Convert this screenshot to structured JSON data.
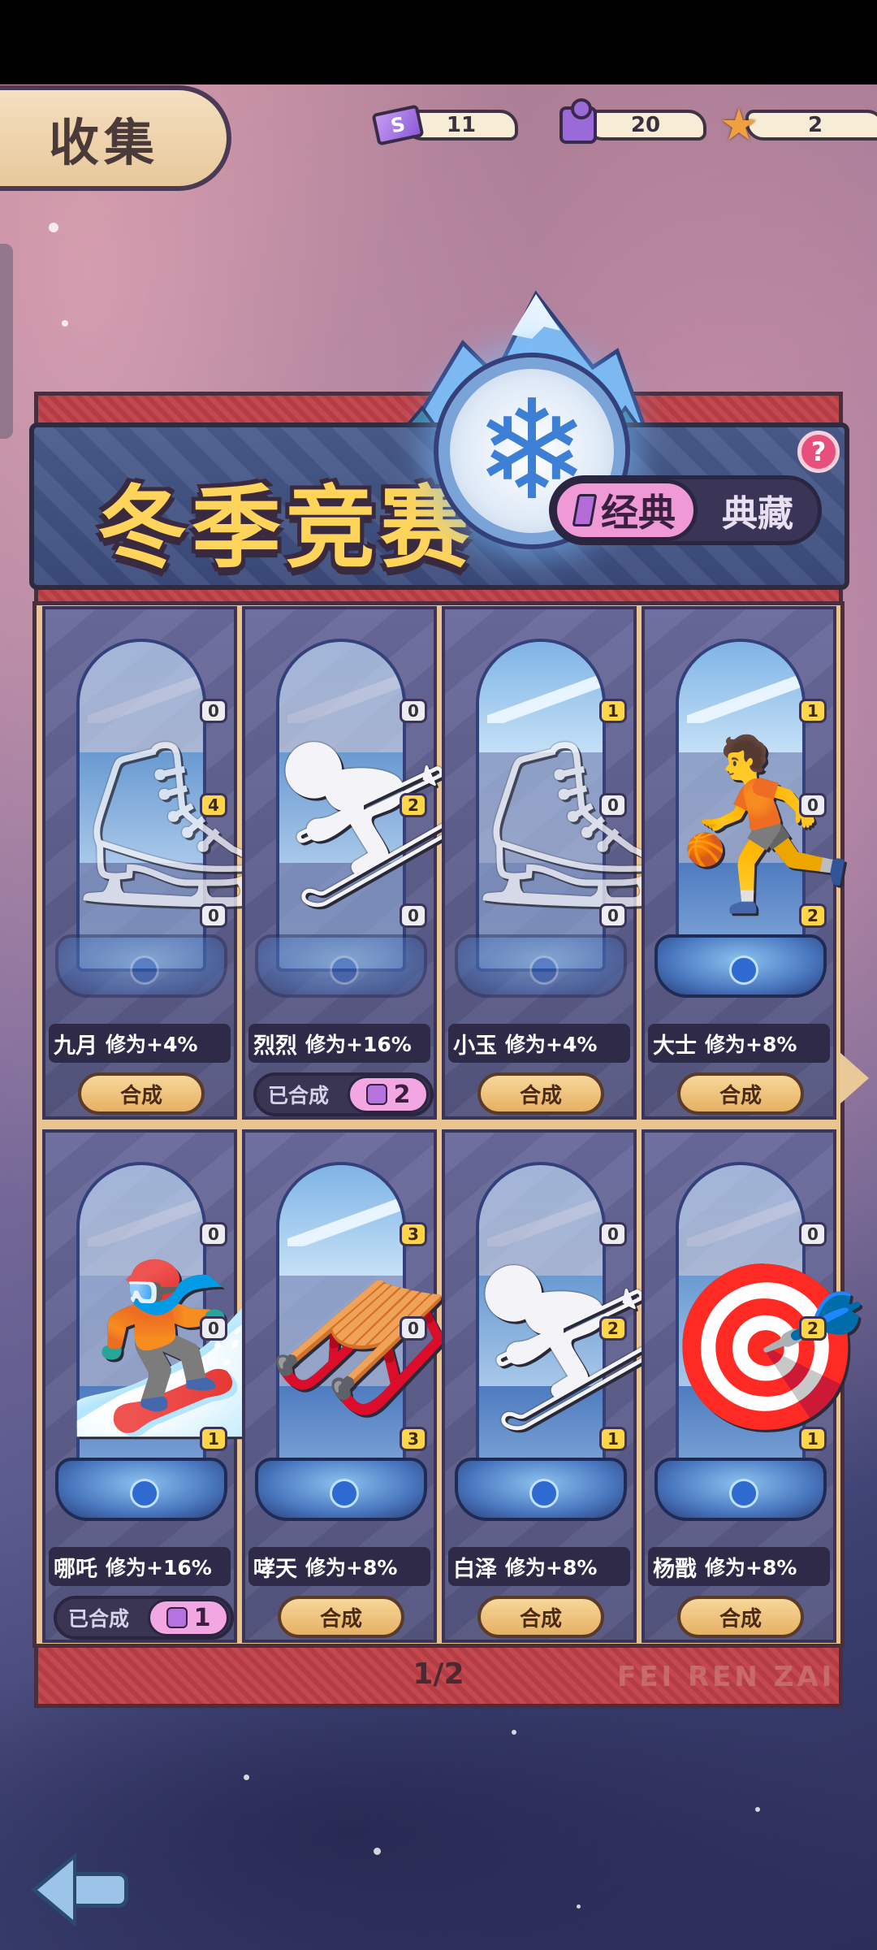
{
  "header": {
    "collect_tab_label": "收集",
    "currencies": [
      {
        "icon": "purple-ticket-icon",
        "value": "11"
      },
      {
        "icon": "purple-puzzle-icon",
        "value": "20"
      },
      {
        "icon": "orange-star-icon",
        "value": "2"
      }
    ]
  },
  "banner": {
    "title": "冬季竞赛",
    "emblem_icon": "snowflake-icon",
    "help_label": "?",
    "toggle_active": "经典",
    "toggle_inactive": "典藏"
  },
  "colors": {
    "title_yellow": "#ffd45a",
    "button_gold": "#e6b164",
    "fragment_pink": "#f2a6e2",
    "count_yellow": "#ffd54a"
  },
  "cards": [
    {
      "name": "九月",
      "bonus": "修为+4%",
      "counts": [
        "0",
        "4",
        "0"
      ],
      "state": "compose",
      "button": "合成",
      "figure_icon": "speed-skater-figure-icon"
    },
    {
      "name": "烈烈",
      "bonus": "修为+16%",
      "counts": [
        "0",
        "2",
        "0"
      ],
      "state": "done",
      "done_label": "已合成",
      "fragments": "2",
      "figure_icon": "skier-figure-icon"
    },
    {
      "name": "小玉",
      "bonus": "修为+4%",
      "counts": [
        "1",
        "0",
        "0"
      ],
      "state": "compose",
      "button": "合成",
      "figure_icon": "figure-skater-figure-icon"
    },
    {
      "name": "大士",
      "bonus": "修为+8%",
      "counts": [
        "1",
        "0",
        "2"
      ],
      "state": "compose",
      "button": "合成",
      "figure_icon": "curler-figure-icon"
    },
    {
      "name": "哪吒",
      "bonus": "修为+16%",
      "counts": [
        "0",
        "0",
        "1"
      ],
      "state": "done",
      "done_label": "已合成",
      "fragments": "1",
      "figure_icon": "snowboarder-figure-icon"
    },
    {
      "name": "哮天",
      "bonus": "修为+8%",
      "counts": [
        "3",
        "0",
        "3"
      ],
      "state": "compose",
      "button": "合成",
      "figure_icon": "skeleton-sled-figure-icon"
    },
    {
      "name": "白泽",
      "bonus": "修为+8%",
      "counts": [
        "0",
        "2",
        "1"
      ],
      "state": "compose",
      "button": "合成",
      "figure_icon": "cross-country-skier-figure-icon"
    },
    {
      "name": "杨戬",
      "bonus": "修为+8%",
      "counts": [
        "0",
        "2",
        "1"
      ],
      "state": "compose",
      "button": "合成",
      "figure_icon": "biathlete-figure-icon"
    }
  ],
  "pager": {
    "indicator": "1/2",
    "next_icon": "next-page-arrow-icon"
  },
  "watermark": "FEI REN ZAI",
  "nav": {
    "back_icon": "back-arrow-icon"
  }
}
